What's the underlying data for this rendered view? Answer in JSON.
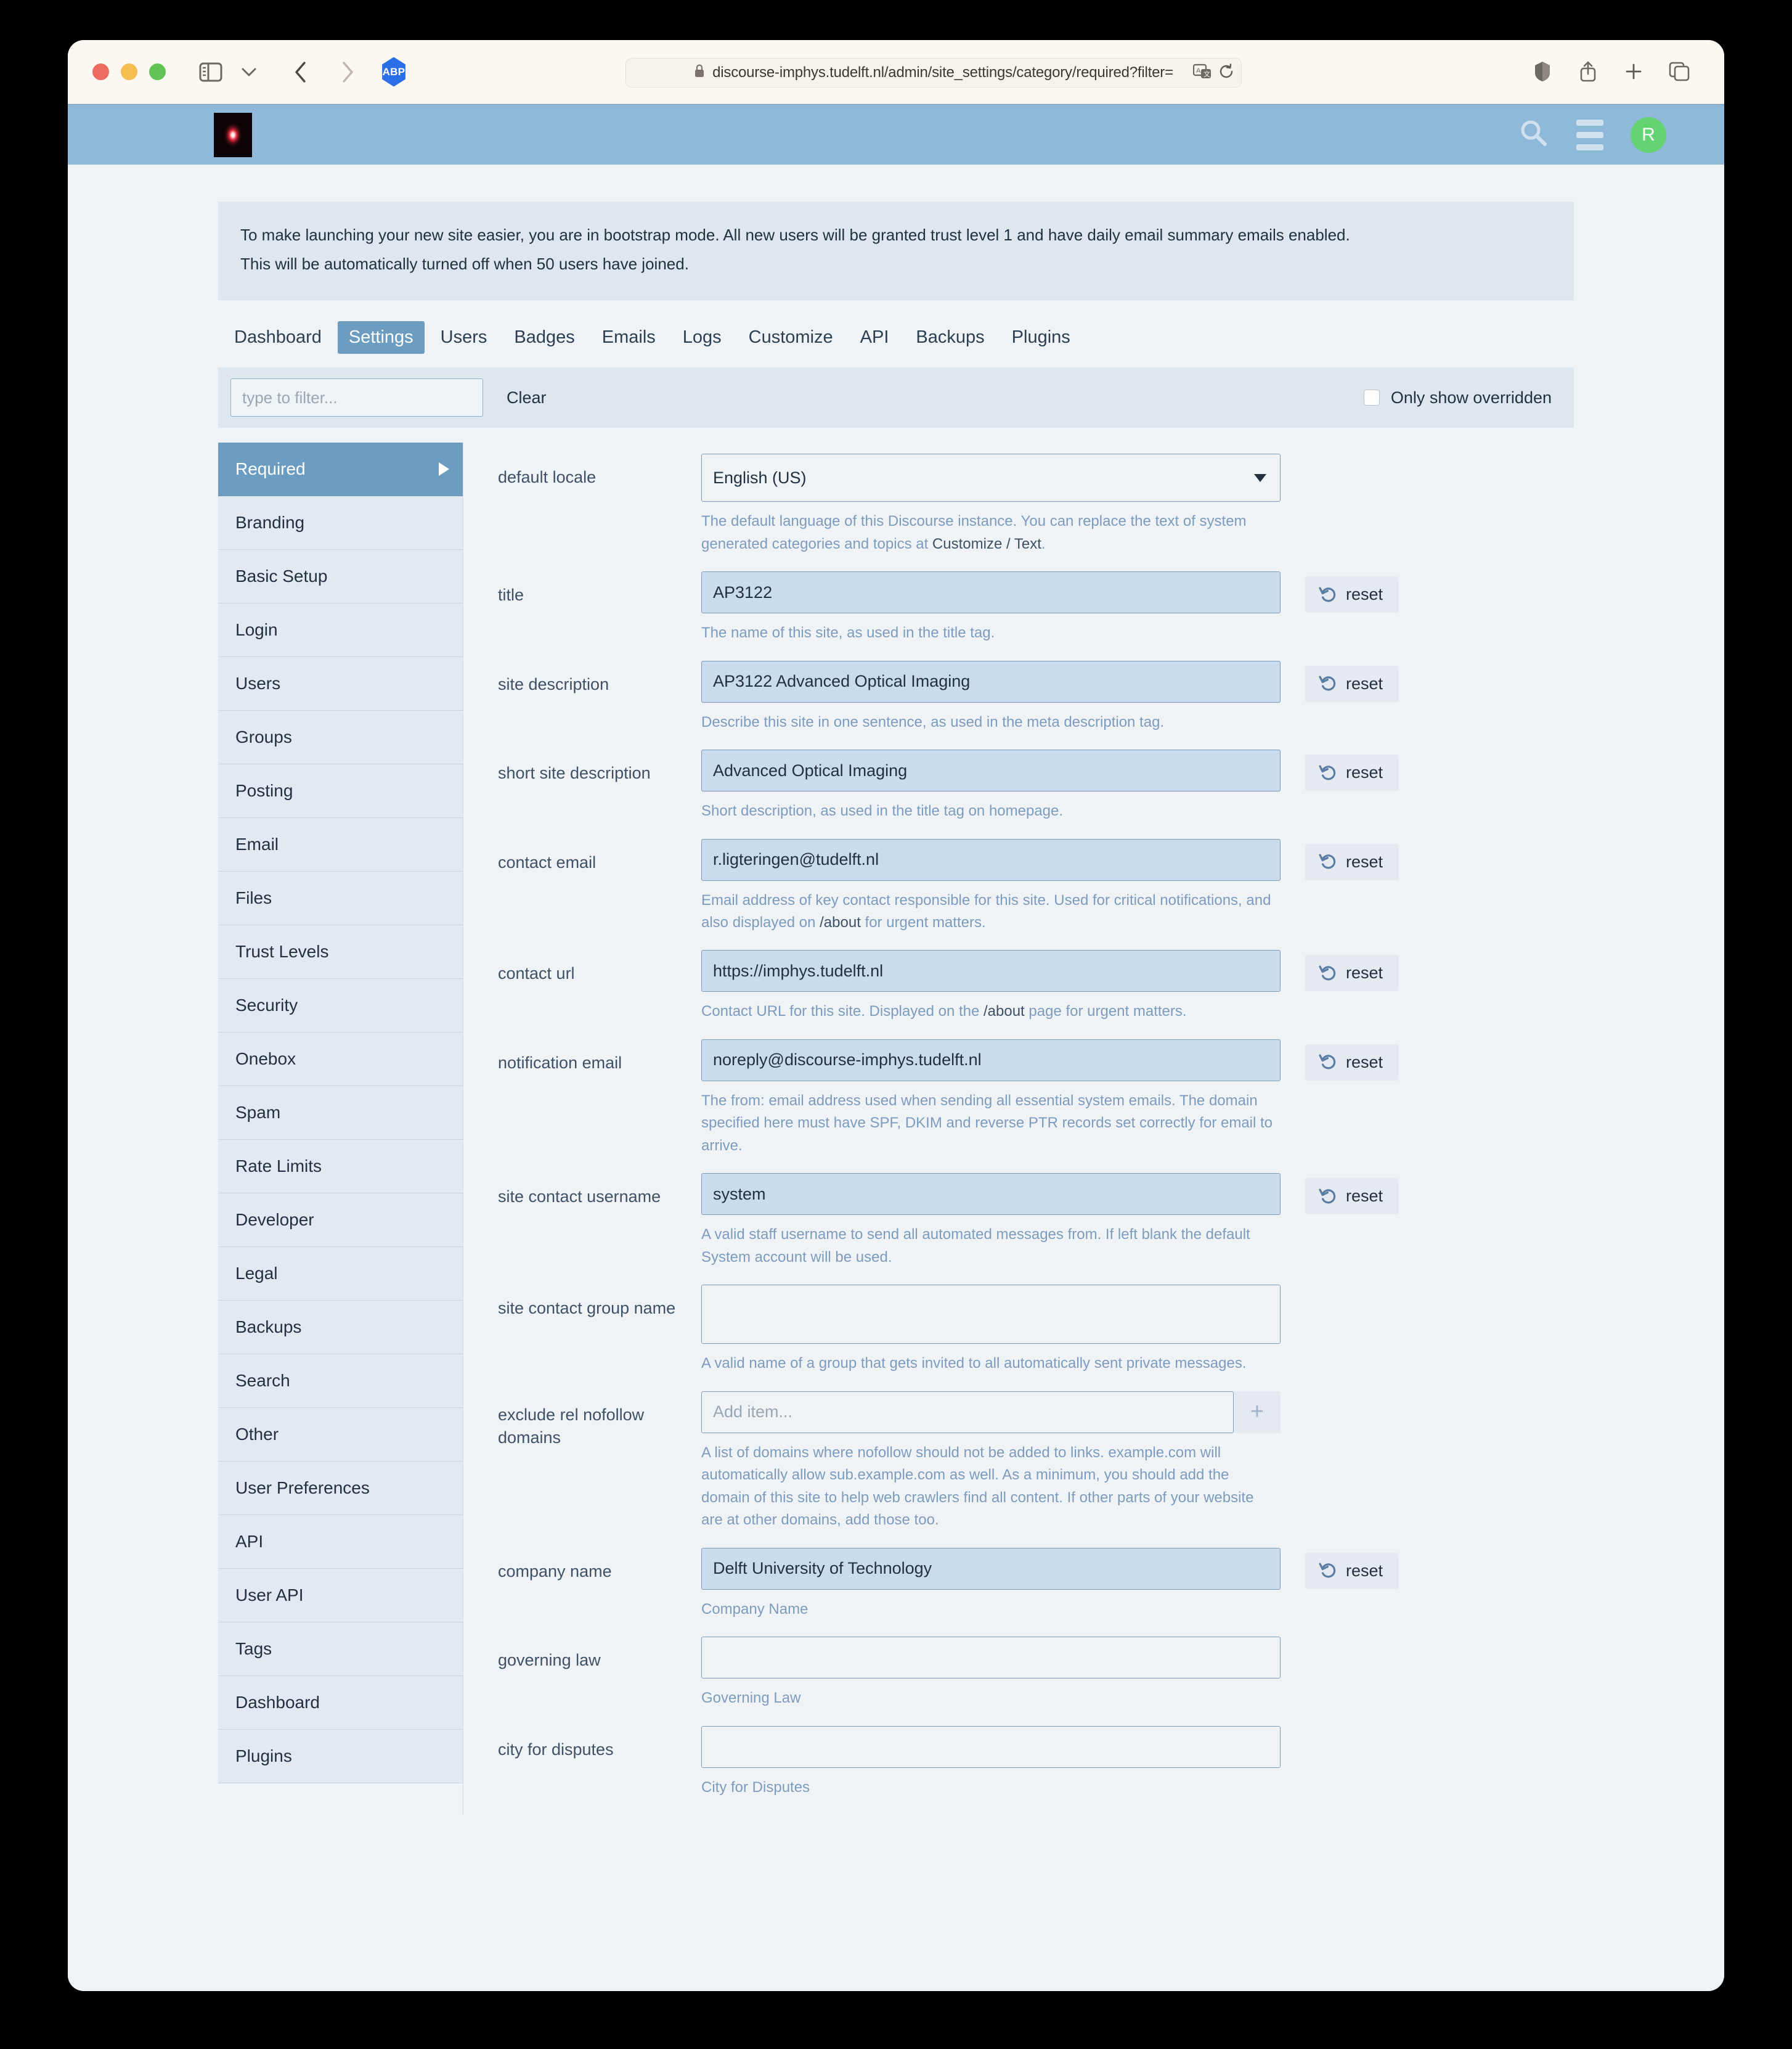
{
  "browser": {
    "url": "discourse-imphys.tudelft.nl/admin/site_settings/category/required?filter=",
    "lock_icon": "lock-icon",
    "adblock_label": "ABP",
    "toolbar_icons": [
      "sidebar-icon",
      "chevron-down-icon",
      "back-icon",
      "forward-icon",
      "translate-icon",
      "reload-icon",
      "reader-icon",
      "share-icon",
      "new-tab-icon",
      "tab-overview-icon"
    ]
  },
  "site_header": {
    "logo_alt": "site-logo",
    "search_icon": "search-icon",
    "menu_icon": "hamburger-icon",
    "avatar_initial": "R",
    "avatar_color": "#63d471",
    "header_color": "#8fb9d9"
  },
  "bootstrap_notice": {
    "line1": "To make launching your new site easier, you are in bootstrap mode. All new users will be granted trust level 1 and have daily email summary emails enabled.",
    "line2": "This will be automatically turned off when 50 users have joined."
  },
  "admin_tabs": [
    {
      "label": "Dashboard",
      "active": false
    },
    {
      "label": "Settings",
      "active": true
    },
    {
      "label": "Users",
      "active": false
    },
    {
      "label": "Badges",
      "active": false
    },
    {
      "label": "Emails",
      "active": false
    },
    {
      "label": "Logs",
      "active": false
    },
    {
      "label": "Customize",
      "active": false
    },
    {
      "label": "API",
      "active": false
    },
    {
      "label": "Backups",
      "active": false
    },
    {
      "label": "Plugins",
      "active": false
    }
  ],
  "filter_bar": {
    "placeholder": "type to filter...",
    "value": "",
    "clear_label": "Clear",
    "overridden_label": "Only show overridden",
    "overridden_checked": false
  },
  "categories": [
    {
      "label": "Required",
      "active": true
    },
    {
      "label": "Branding",
      "active": false
    },
    {
      "label": "Basic Setup",
      "active": false
    },
    {
      "label": "Login",
      "active": false
    },
    {
      "label": "Users",
      "active": false
    },
    {
      "label": "Groups",
      "active": false
    },
    {
      "label": "Posting",
      "active": false
    },
    {
      "label": "Email",
      "active": false
    },
    {
      "label": "Files",
      "active": false
    },
    {
      "label": "Trust Levels",
      "active": false
    },
    {
      "label": "Security",
      "active": false
    },
    {
      "label": "Onebox",
      "active": false
    },
    {
      "label": "Spam",
      "active": false
    },
    {
      "label": "Rate Limits",
      "active": false
    },
    {
      "label": "Developer",
      "active": false
    },
    {
      "label": "Legal",
      "active": false
    },
    {
      "label": "Backups",
      "active": false
    },
    {
      "label": "Search",
      "active": false
    },
    {
      "label": "Other",
      "active": false
    },
    {
      "label": "User Preferences",
      "active": false
    },
    {
      "label": "API",
      "active": false
    },
    {
      "label": "User API",
      "active": false
    },
    {
      "label": "Tags",
      "active": false
    },
    {
      "label": "Dashboard",
      "active": false
    },
    {
      "label": "Plugins",
      "active": false
    }
  ],
  "reset_label": "reset",
  "settings": [
    {
      "name": "default locale",
      "type": "select",
      "value": "English (US)",
      "desc_pre": "The default language of this Discourse instance. You can replace the text of system generated categories and topics at ",
      "desc_link": "Customize / Text",
      "desc_post": ".",
      "overridden": false,
      "has_reset": false
    },
    {
      "name": "title",
      "type": "text",
      "value": "AP3122",
      "desc_pre": "The name of this site, as used in the title tag.",
      "desc_link": "",
      "desc_post": "",
      "overridden": true,
      "has_reset": true
    },
    {
      "name": "site description",
      "type": "text",
      "value": "AP3122 Advanced Optical Imaging",
      "desc_pre": "Describe this site in one sentence, as used in the meta description tag.",
      "desc_link": "",
      "desc_post": "",
      "overridden": true,
      "has_reset": true
    },
    {
      "name": "short site description",
      "type": "text",
      "value": "Advanced Optical Imaging",
      "desc_pre": "Short description, as used in the title tag on homepage.",
      "desc_link": "",
      "desc_post": "",
      "overridden": true,
      "has_reset": true
    },
    {
      "name": "contact email",
      "type": "text",
      "value": "r.ligteringen@tudelft.nl",
      "desc_pre": "Email address of key contact responsible for this site. Used for critical notifications, and also displayed on ",
      "desc_link": "/about",
      "desc_post": " for urgent matters.",
      "overridden": true,
      "has_reset": true
    },
    {
      "name": "contact url",
      "type": "text",
      "value": "https://imphys.tudelft.nl",
      "desc_pre": "Contact URL for this site. Displayed on the ",
      "desc_link": "/about",
      "desc_post": " page for urgent matters.",
      "overridden": true,
      "has_reset": true
    },
    {
      "name": "notification email",
      "type": "text",
      "value": "noreply@discourse-imphys.tudelft.nl",
      "desc_pre": "The from: email address used when sending all essential system emails. The domain specified here must have SPF, DKIM and reverse PTR records set correctly for email to arrive.",
      "desc_link": "",
      "desc_post": "",
      "overridden": true,
      "has_reset": true
    },
    {
      "name": "site contact username",
      "type": "text",
      "value": "system",
      "desc_pre": "A valid staff username to send all automated messages from. If left blank the default System account will be used.",
      "desc_link": "",
      "desc_post": "",
      "overridden": true,
      "has_reset": true
    },
    {
      "name": "site contact group name",
      "type": "text",
      "value": "",
      "desc_pre": "A valid name of a group that gets invited to all automatically sent private messages.",
      "desc_link": "",
      "desc_post": "",
      "overridden": false,
      "has_reset": false,
      "tall": true
    },
    {
      "name": "exclude rel nofollow domains",
      "type": "list",
      "value": "",
      "placeholder": "Add item...",
      "add_icon": "plus-icon",
      "desc_pre": "A list of domains where nofollow should not be added to links. example.com will automatically allow sub.example.com as well. As a minimum, you should add the domain of this site to help web crawlers find all content. If other parts of your website are at other domains, add those too.",
      "desc_link": "",
      "desc_post": "",
      "overridden": false,
      "has_reset": false
    },
    {
      "name": "company name",
      "type": "text",
      "value": "Delft University of Technology",
      "desc_pre": "Company Name",
      "desc_link": "",
      "desc_post": "",
      "overridden": true,
      "has_reset": true
    },
    {
      "name": "governing law",
      "type": "text",
      "value": "",
      "desc_pre": "Governing Law",
      "desc_link": "",
      "desc_post": "",
      "overridden": false,
      "has_reset": false
    },
    {
      "name": "city for disputes",
      "type": "text",
      "value": "",
      "desc_pre": "City for Disputes",
      "desc_link": "",
      "desc_post": "",
      "overridden": false,
      "has_reset": false
    }
  ]
}
